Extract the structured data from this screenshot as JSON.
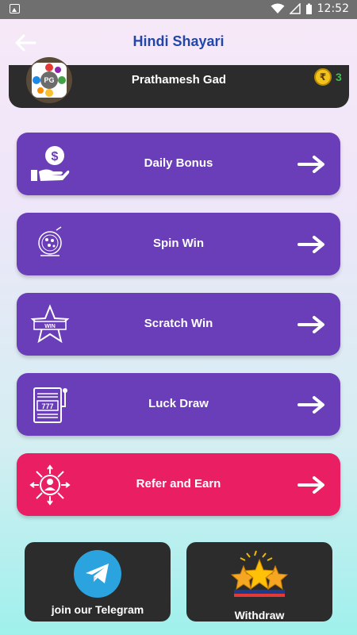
{
  "status_bar": {
    "time": "12:52"
  },
  "app_bar": {
    "title": "Hindi Shayari"
  },
  "profile": {
    "name": "Prathamesh Gad",
    "avatar_initials": "PG",
    "coin_symbol": "₹",
    "coins": "3"
  },
  "menu": [
    {
      "label": "Daily Bonus",
      "icon": "hand-dollar-icon",
      "color": "#6a3db9"
    },
    {
      "label": "Spin Win",
      "icon": "spin-wheel-icon",
      "color": "#6a3db9"
    },
    {
      "label": "Scratch Win",
      "icon": "star-win-icon",
      "color": "#6a3db9"
    },
    {
      "label": "Luck Draw",
      "icon": "slot-machine-icon",
      "color": "#6a3db9"
    },
    {
      "label": "Refer and Earn",
      "icon": "refer-network-icon",
      "color": "#e91e63"
    }
  ],
  "bottom": {
    "telegram_label": "join our Telegram",
    "withdraw_label": "Withdraw"
  }
}
